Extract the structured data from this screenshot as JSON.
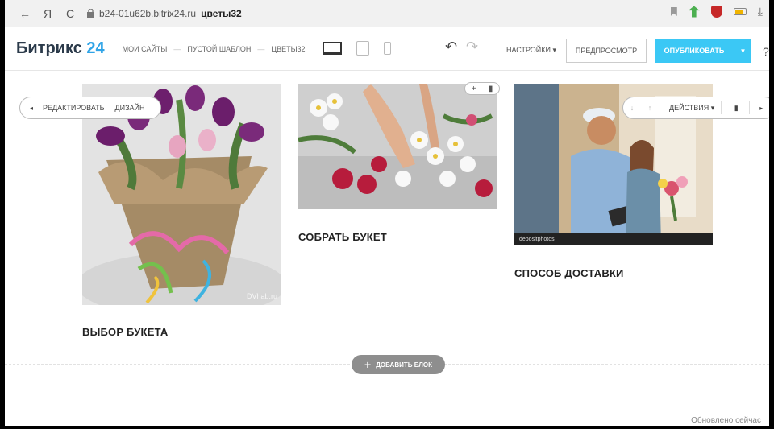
{
  "browser": {
    "back_glyph": "←",
    "yandex_glyph": "Я",
    "reload_glyph": "C",
    "host": "b24-01u62b.bitrix24.ru",
    "page_title": "цветы32"
  },
  "toolbar": {
    "logo_text": "Битрикс",
    "logo_number": "24",
    "breadcrumbs": [
      "МОИ САЙТЫ",
      "ПУСТОЙ ШАБЛОН",
      "ЦВЕТЫ32"
    ],
    "breadcrumb_sep": "—",
    "settings_label": "НАСТРОЙКИ",
    "preview_label": "ПРЕДПРОСМОТР",
    "publish_label": "ОПУБЛИКОВАТЬ",
    "help_label": "?",
    "accent_color": "#3bc8f5"
  },
  "block_controls": {
    "edit_label": "РЕДАКТИРОВАТЬ",
    "design_label": "ДИЗАЙН",
    "actions_label": "ДЕЙСТВИЯ"
  },
  "cards": [
    {
      "title": "ВЫБОР БУКЕТА",
      "watermark": "DVhab.ru"
    },
    {
      "title": "СОБРАТЬ БУКЕТ"
    },
    {
      "title": "СПОСОБ ДОСТАВКИ",
      "watermark": "depositphotos"
    }
  ],
  "add_block_label": "ДОБАВИТЬ БЛОК",
  "status_text": "Обновлено сейчас"
}
